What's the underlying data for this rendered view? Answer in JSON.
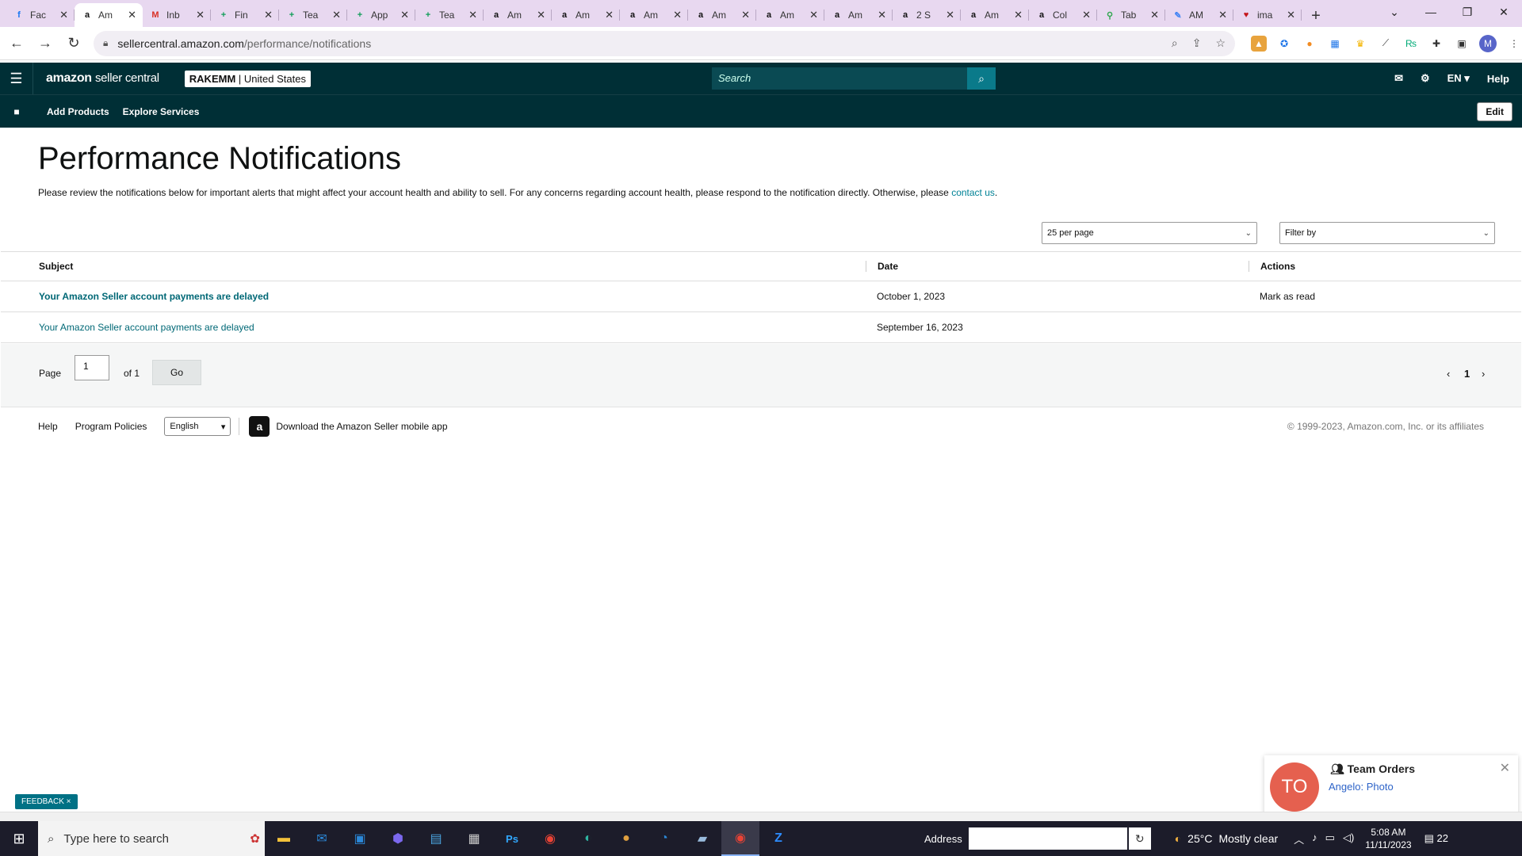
{
  "browser": {
    "tabs": [
      {
        "title": "Fac",
        "icon": "facebook-icon",
        "color": "#1877f2",
        "glyph": "f"
      },
      {
        "title": "Am",
        "icon": "amazon-icon",
        "color": "#111111",
        "glyph": "a",
        "active": true
      },
      {
        "title": "Inb",
        "icon": "gmail-icon",
        "color": "#d93025",
        "glyph": "M"
      },
      {
        "title": "Fin",
        "icon": "sheets-icon",
        "color": "#0f9d58",
        "glyph": "+"
      },
      {
        "title": "Tea",
        "icon": "sheets-icon",
        "color": "#0f9d58",
        "glyph": "+"
      },
      {
        "title": "App",
        "icon": "sheets-icon",
        "color": "#0f9d58",
        "glyph": "+"
      },
      {
        "title": "Tea",
        "icon": "sheets-icon",
        "color": "#0f9d58",
        "glyph": "+"
      },
      {
        "title": "Am",
        "icon": "amazon-icon",
        "color": "#111111",
        "glyph": "a"
      },
      {
        "title": "Am",
        "icon": "amazon-icon",
        "color": "#111111",
        "glyph": "a"
      },
      {
        "title": "Am",
        "icon": "amazon-icon",
        "color": "#111111",
        "glyph": "a"
      },
      {
        "title": "Am",
        "icon": "amazon-icon",
        "color": "#111111",
        "glyph": "a"
      },
      {
        "title": "Am",
        "icon": "amazon-icon",
        "color": "#111111",
        "glyph": "a"
      },
      {
        "title": "Am",
        "icon": "amazon-icon",
        "color": "#111111",
        "glyph": "a"
      },
      {
        "title": "2 S",
        "icon": "amazon-icon",
        "color": "#111111",
        "glyph": "a"
      },
      {
        "title": "Am",
        "icon": "amazon-icon",
        "color": "#111111",
        "glyph": "a"
      },
      {
        "title": "Col",
        "icon": "amazon-icon",
        "color": "#111111",
        "glyph": "a"
      },
      {
        "title": "Tab",
        "icon": "maps-icon",
        "color": "#34a853",
        "glyph": "⚲"
      },
      {
        "title": "AM",
        "icon": "pen-icon",
        "color": "#4285f4",
        "glyph": "✎"
      },
      {
        "title": "ima",
        "icon": "heart-icon",
        "color": "#c4161c",
        "glyph": "♥"
      }
    ],
    "url_host": "sellercentral.amazon.com",
    "url_path": "/performance/notifications",
    "profile_initial": "M"
  },
  "header": {
    "logo_main": "amazon",
    "logo_sub": "seller central",
    "account_name": "RAKEMM",
    "account_region": "| United States",
    "search_placeholder": "Search",
    "language": "EN",
    "help": "Help"
  },
  "subnav": {
    "items": [
      "Add Products",
      "Explore Services"
    ],
    "edit": "Edit"
  },
  "page": {
    "title": "Performance Notifications",
    "description": "Please review the notifications below for important alerts that might affect your account health and ability to sell. For any concerns regarding account health, please respond to the notification directly. Otherwise, please ",
    "contact_link": "contact us",
    "description_end": ".",
    "per_page": "25 per page",
    "filter_by": "Filter by"
  },
  "table": {
    "columns": [
      "Subject",
      "Date",
      "Actions"
    ],
    "rows": [
      {
        "subject": "Your Amazon Seller account payments are delayed",
        "date": "October 1, 2023",
        "action": "Mark as read",
        "unread": true
      },
      {
        "subject": "Your Amazon Seller account payments are delayed",
        "date": "September 16, 2023",
        "action": "",
        "unread": false
      }
    ]
  },
  "pager": {
    "page_label": "Page",
    "page_value": "1",
    "of_label": "of 1",
    "go": "Go",
    "current": "1",
    "prev": "‹",
    "next": "›"
  },
  "footer": {
    "help": "Help",
    "program_policies": "Program Policies",
    "language": "English",
    "app_text": "Download the Amazon Seller mobile app",
    "copyright": "© 1999-2023, Amazon.com, Inc. or its affiliates"
  },
  "feedback": "FEEDBACK ×",
  "toast": {
    "initials": "TO",
    "title": "Team Orders",
    "message": "Angelo: Photo"
  },
  "taskbar": {
    "search_placeholder": "Type here to search",
    "address_label": "Address",
    "temperature": "25°C",
    "weather": "Mostly clear",
    "time": "5:08 AM",
    "date": "11/11/2023",
    "notifications": "22"
  }
}
